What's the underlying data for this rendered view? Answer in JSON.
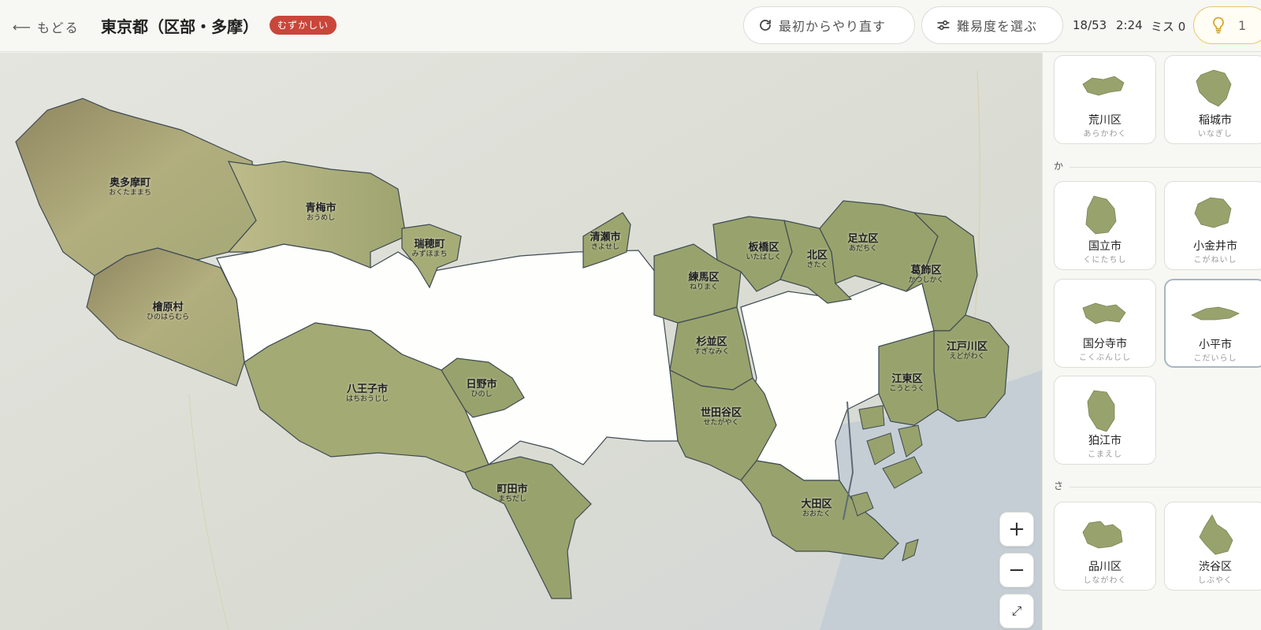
{
  "header": {
    "back_label": "もどる",
    "title": "東京都（区部・多摩）",
    "difficulty_badge": "むずかしい",
    "restart_label": "最初からやり直す",
    "choose_level_label": "難易度を選ぶ",
    "progress": "18/53",
    "timer": "2:24",
    "misses": "ミス 0",
    "hints": "1"
  },
  "map": {
    "zoom_in": "+",
    "zoom_out": "−",
    "fullscreen": "⤢",
    "regions": [
      {
        "name": "奥多摩町",
        "reading": "おくたままち"
      },
      {
        "name": "青梅市",
        "reading": "おうめし"
      },
      {
        "name": "瑞穂町",
        "reading": "みずほまち"
      },
      {
        "name": "清瀬市",
        "reading": "きよせし"
      },
      {
        "name": "檜原村",
        "reading": "ひのはらむら"
      },
      {
        "name": "八王子市",
        "reading": "はちおうじし"
      },
      {
        "name": "日野市",
        "reading": "ひのし"
      },
      {
        "name": "町田市",
        "reading": "まちだし"
      },
      {
        "name": "板橋区",
        "reading": "いたばしく"
      },
      {
        "name": "北区",
        "reading": "きたく"
      },
      {
        "name": "足立区",
        "reading": "あだちく"
      },
      {
        "name": "葛飾区",
        "reading": "かつしかく"
      },
      {
        "name": "練馬区",
        "reading": "ねりまく"
      },
      {
        "name": "杉並区",
        "reading": "すぎなみく"
      },
      {
        "name": "江戸川区",
        "reading": "えどがわく"
      },
      {
        "name": "江東区",
        "reading": "こうとうく"
      },
      {
        "name": "世田谷区",
        "reading": "せたがやく"
      },
      {
        "name": "大田区",
        "reading": "おおたく"
      }
    ]
  },
  "sidebar": {
    "sections": [
      "か",
      "さ"
    ],
    "cards": [
      {
        "name": "荒川区",
        "reading": "あらかわく"
      },
      {
        "name": "稲城市",
        "reading": "いなぎし"
      },
      {
        "name": "国立市",
        "reading": "くにたちし"
      },
      {
        "name": "小金井市",
        "reading": "こがねいし"
      },
      {
        "name": "国分寺市",
        "reading": "こくぶんじし"
      },
      {
        "name": "小平市",
        "reading": "こだいらし"
      },
      {
        "name": "狛江市",
        "reading": "こまえし"
      },
      {
        "name": "品川区",
        "reading": "しながわく"
      },
      {
        "name": "渋谷区",
        "reading": "しぶやく"
      }
    ]
  },
  "colors": {
    "placed_region": "#98a26c",
    "mountain_region": "#9c9a6a",
    "unplaced_region": "#ffffff",
    "water": "#c9d1d8",
    "badge": "#c9463a",
    "hint_border": "#e7c96a"
  }
}
